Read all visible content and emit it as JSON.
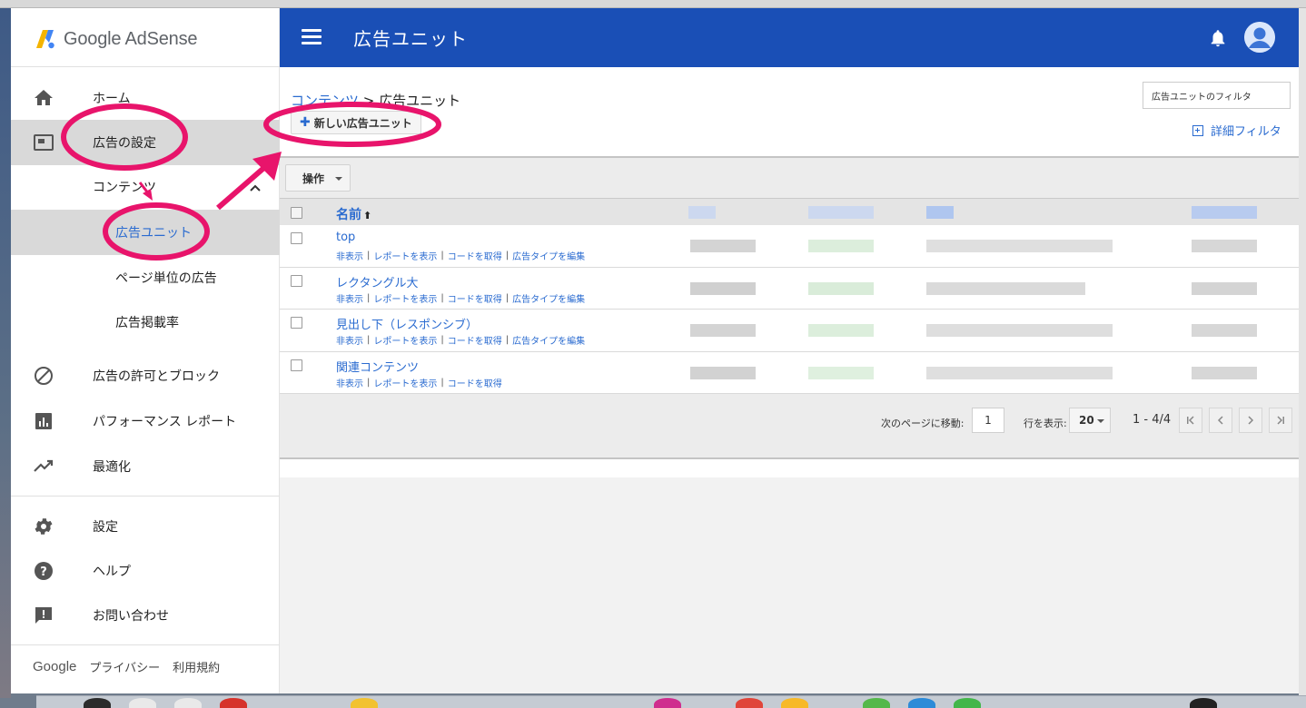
{
  "app": {
    "logo_text": "Google AdSense",
    "page_title": "広告ユニット"
  },
  "sidebar": {
    "items": [
      {
        "label": "ホーム",
        "icon": "home-icon"
      },
      {
        "label": "広告の設定",
        "icon": "ad-settings-icon"
      },
      {
        "label": "コンテンツ",
        "icon": "chevron-up-icon"
      },
      {
        "label": "広告ユニット"
      },
      {
        "label": "ページ単位の広告"
      },
      {
        "label": "広告掲載率"
      },
      {
        "label": "広告の許可とブロック",
        "icon": "block-icon"
      },
      {
        "label": "パフォーマンス レポート",
        "icon": "bar-chart-icon"
      },
      {
        "label": "最適化",
        "icon": "trending-up-icon"
      },
      {
        "label": "設定",
        "icon": "gear-icon"
      },
      {
        "label": "ヘルプ",
        "icon": "help-icon"
      },
      {
        "label": "お問い合わせ",
        "icon": "feedback-icon"
      }
    ],
    "footer": {
      "google": "Google",
      "privacy": "プライバシー",
      "terms": "利用規約"
    }
  },
  "content": {
    "breadcrumb_parent": "コンテンツ",
    "breadcrumb_sep": ">",
    "breadcrumb_current": "広告ユニット",
    "new_button": "新しい広告ユニット",
    "filter_placeholder": "広告ユニットのフィルタ",
    "advanced_filter": "詳細フィルタ",
    "ops_button": "操作",
    "column_name": "名前",
    "rows": [
      {
        "name": "top",
        "actions": [
          "非表示",
          "レポートを表示",
          "コードを取得",
          "広告タイプを編集"
        ]
      },
      {
        "name": "レクタングル大",
        "actions": [
          "非表示",
          "レポートを表示",
          "コードを取得",
          "広告タイプを編集"
        ]
      },
      {
        "name": "見出し下（レスポンシブ）",
        "actions": [
          "非表示",
          "レポートを表示",
          "コードを取得",
          "広告タイプを編集"
        ]
      },
      {
        "name": "関連コンテンツ",
        "actions": [
          "非表示",
          "レポートを表示",
          "コードを取得"
        ]
      }
    ],
    "pager": {
      "goto_label": "次のページに移動:",
      "goto_value": "1",
      "rows_label": "行を表示:",
      "rows_value": "20",
      "range": "1 - 4/4"
    }
  },
  "colors": {
    "header_blue": "#1a4fb6",
    "link_blue": "#2a6bd0",
    "annotation_magenta": "#e8146b"
  }
}
